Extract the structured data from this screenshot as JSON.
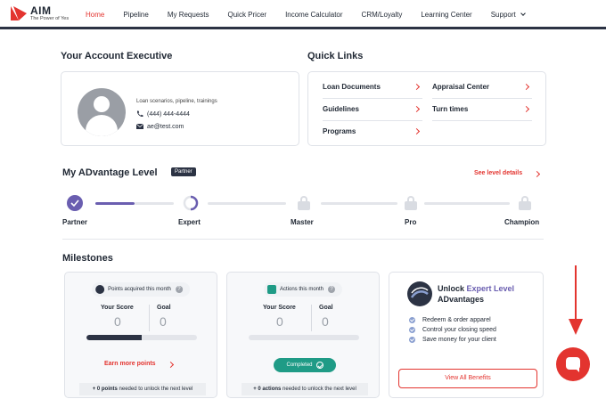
{
  "brand": {
    "name": "AIM",
    "tagline": "The Power of Yes"
  },
  "nav": {
    "items": [
      {
        "label": "Home"
      },
      {
        "label": "Pipeline"
      },
      {
        "label": "My Requests"
      },
      {
        "label": "Quick Pricer"
      },
      {
        "label": "Income Calculator"
      },
      {
        "label": "CRM/Loyalty"
      },
      {
        "label": "Learning Center"
      },
      {
        "label": "Support"
      }
    ],
    "active": "Home"
  },
  "account_exec": {
    "title": "Your Account Executive",
    "description": "Loan scenarios, pipeline, trainings",
    "phone": "(444) 444-4444",
    "email": "ae@test.com"
  },
  "quick_links": {
    "title": "Quick Links",
    "items": [
      {
        "label": "Loan Documents"
      },
      {
        "label": "Appraisal Center"
      },
      {
        "label": "Guidelines"
      },
      {
        "label": "Turn times"
      },
      {
        "label": "Programs"
      }
    ]
  },
  "advantage": {
    "title": "My ADvantage Level",
    "badge": "Partner",
    "see_details": "See level details",
    "levels": [
      {
        "label": "Partner",
        "status": "complete"
      },
      {
        "label": "Expert",
        "status": "in-progress"
      },
      {
        "label": "Master",
        "status": "locked"
      },
      {
        "label": "Pro",
        "status": "locked"
      },
      {
        "label": "Champion",
        "status": "locked"
      }
    ]
  },
  "milestones": {
    "title": "Milestones",
    "points_card": {
      "header": "Points acquired this month",
      "score_label": "Your Score",
      "score": "0",
      "goal_label": "Goal",
      "goal": "0",
      "progress": 0.5,
      "link": "Earn more points",
      "footer_count": "+ 0 points",
      "footer_rest": " needed to unlock the next level"
    },
    "actions_card": {
      "header": "Actions this month",
      "score_label": "Your Score",
      "score": "0",
      "goal_label": "Goal",
      "goal": "0",
      "status": "Completed",
      "footer_count": "+ 0 actions",
      "footer_rest": " needed to unlock the next level"
    },
    "unlock_card": {
      "title_prefix": "Unlock ",
      "title_accent": "Expert Level",
      "title_suffix": "ADvantages",
      "benefits": [
        "Redeem & order apparel",
        "Control your closing speed",
        "Save money for your client"
      ],
      "button": "View All Benefits"
    }
  },
  "colors": {
    "accent": "#e3342f",
    "navy": "#2c3344",
    "purple": "#6a5eb0",
    "teal": "#1f9b86"
  }
}
